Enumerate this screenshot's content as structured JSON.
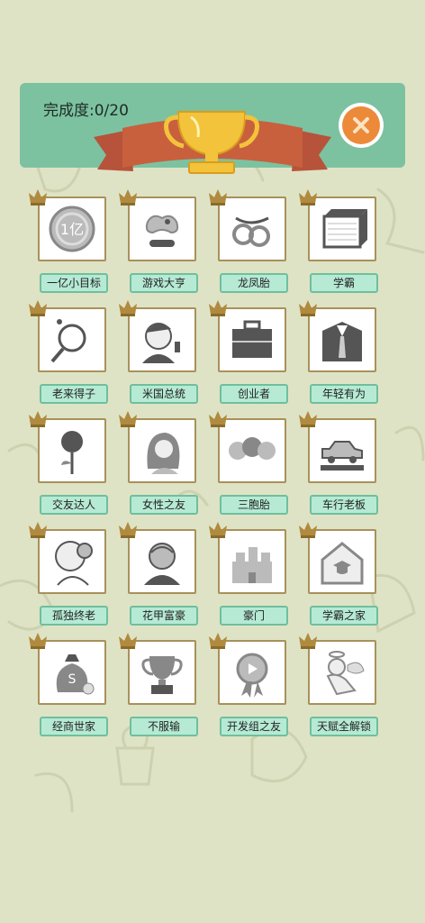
{
  "header": {
    "progress_text": "完成度:0/20"
  },
  "achievements": [
    {
      "label": "一亿小目标",
      "icon": "coin-icon"
    },
    {
      "label": "游戏大亨",
      "icon": "gamepad-icon"
    },
    {
      "label": "龙凤胎",
      "icon": "baby-pacifier-icon"
    },
    {
      "label": "学霸",
      "icon": "book-stack-icon"
    },
    {
      "label": "老来得子",
      "icon": "magnifier-icon"
    },
    {
      "label": "米国总统",
      "icon": "president-icon"
    },
    {
      "label": "创业者",
      "icon": "briefcase-icon"
    },
    {
      "label": "年轻有为",
      "icon": "suit-icon"
    },
    {
      "label": "交友达人",
      "icon": "rose-icon"
    },
    {
      "label": "女性之友",
      "icon": "woman-icon"
    },
    {
      "label": "三胞胎",
      "icon": "triplets-icon"
    },
    {
      "label": "车行老板",
      "icon": "car-icon"
    },
    {
      "label": "孤独终老",
      "icon": "old-man-icon"
    },
    {
      "label": "花甲富豪",
      "icon": "rich-elder-icon"
    },
    {
      "label": "豪门",
      "icon": "castle-icon"
    },
    {
      "label": "学霸之家",
      "icon": "graduation-house-icon"
    },
    {
      "label": "经商世家",
      "icon": "money-bag-icon"
    },
    {
      "label": "不服输",
      "icon": "trophy-icon"
    },
    {
      "label": "开发组之友",
      "icon": "medal-icon"
    },
    {
      "label": "天赋全解锁",
      "icon": "angel-icon"
    }
  ],
  "colors": {
    "background": "#dfe3c6",
    "header": "#7cc2a0",
    "close_button": "#ec8a3a",
    "ribbon": "#c8603e",
    "trophy": "#f2c33b",
    "label_fill": "#b6ead5",
    "card_border": "#a8915a"
  }
}
